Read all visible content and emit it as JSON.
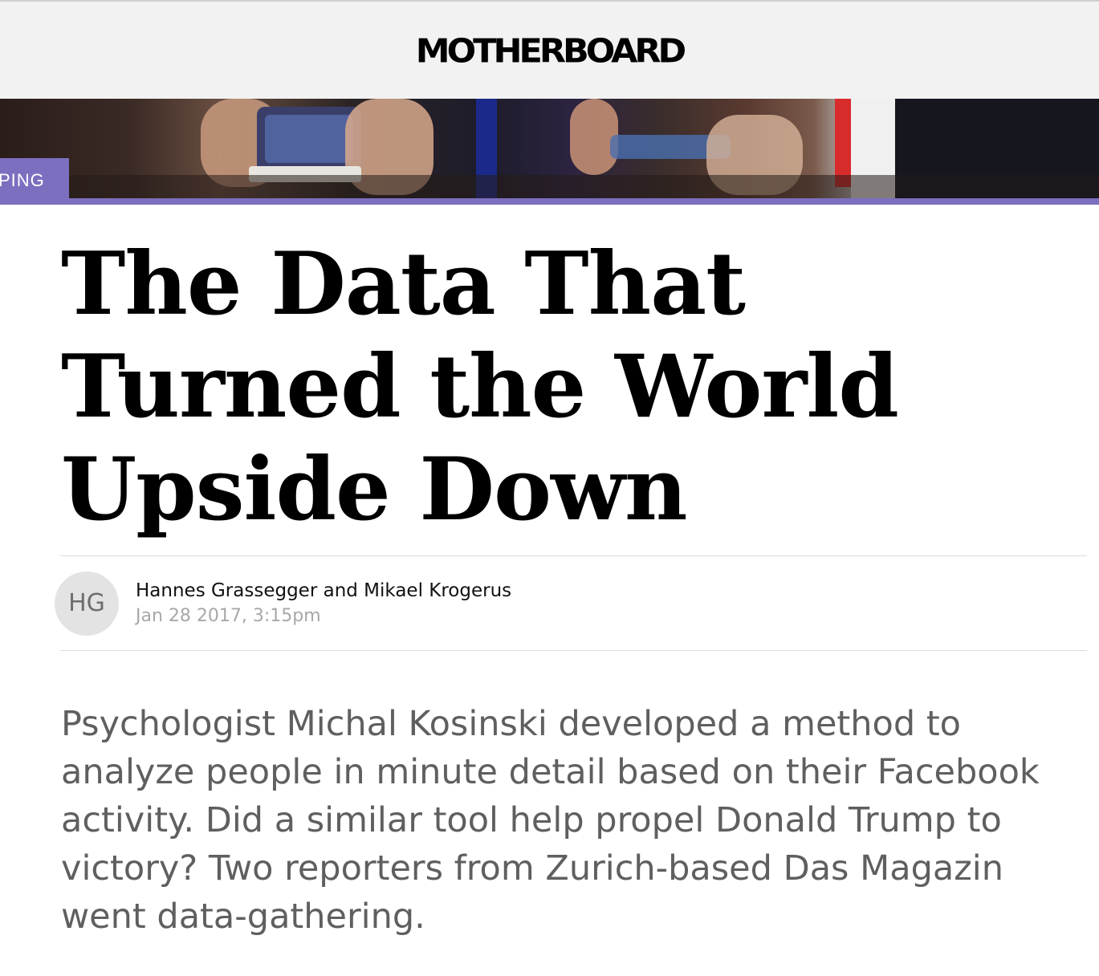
{
  "brand": {
    "logo_text": "MOTHERBOARD"
  },
  "hero": {
    "section_tag": "PING"
  },
  "article": {
    "headline": "The Data That Turned the World Upside Down",
    "author": "Hannes Grassegger and Mikael Krogerus",
    "author_initials": "HG",
    "date": "Jan 28 2017, 3:15pm",
    "dek": "Psychologist Michal Kosinski developed a method to analyze people in minute detail based on their Facebook activity. Did a similar tool help propel Donald Trump to victory? Two reporters from Zurich-based Das Magazin went data-gathering."
  },
  "colors": {
    "accent": "#7c6fc0",
    "header_bg": "#f2f2f2",
    "dek_text": "#5f5f5f",
    "date_text": "#a8a8a8"
  }
}
